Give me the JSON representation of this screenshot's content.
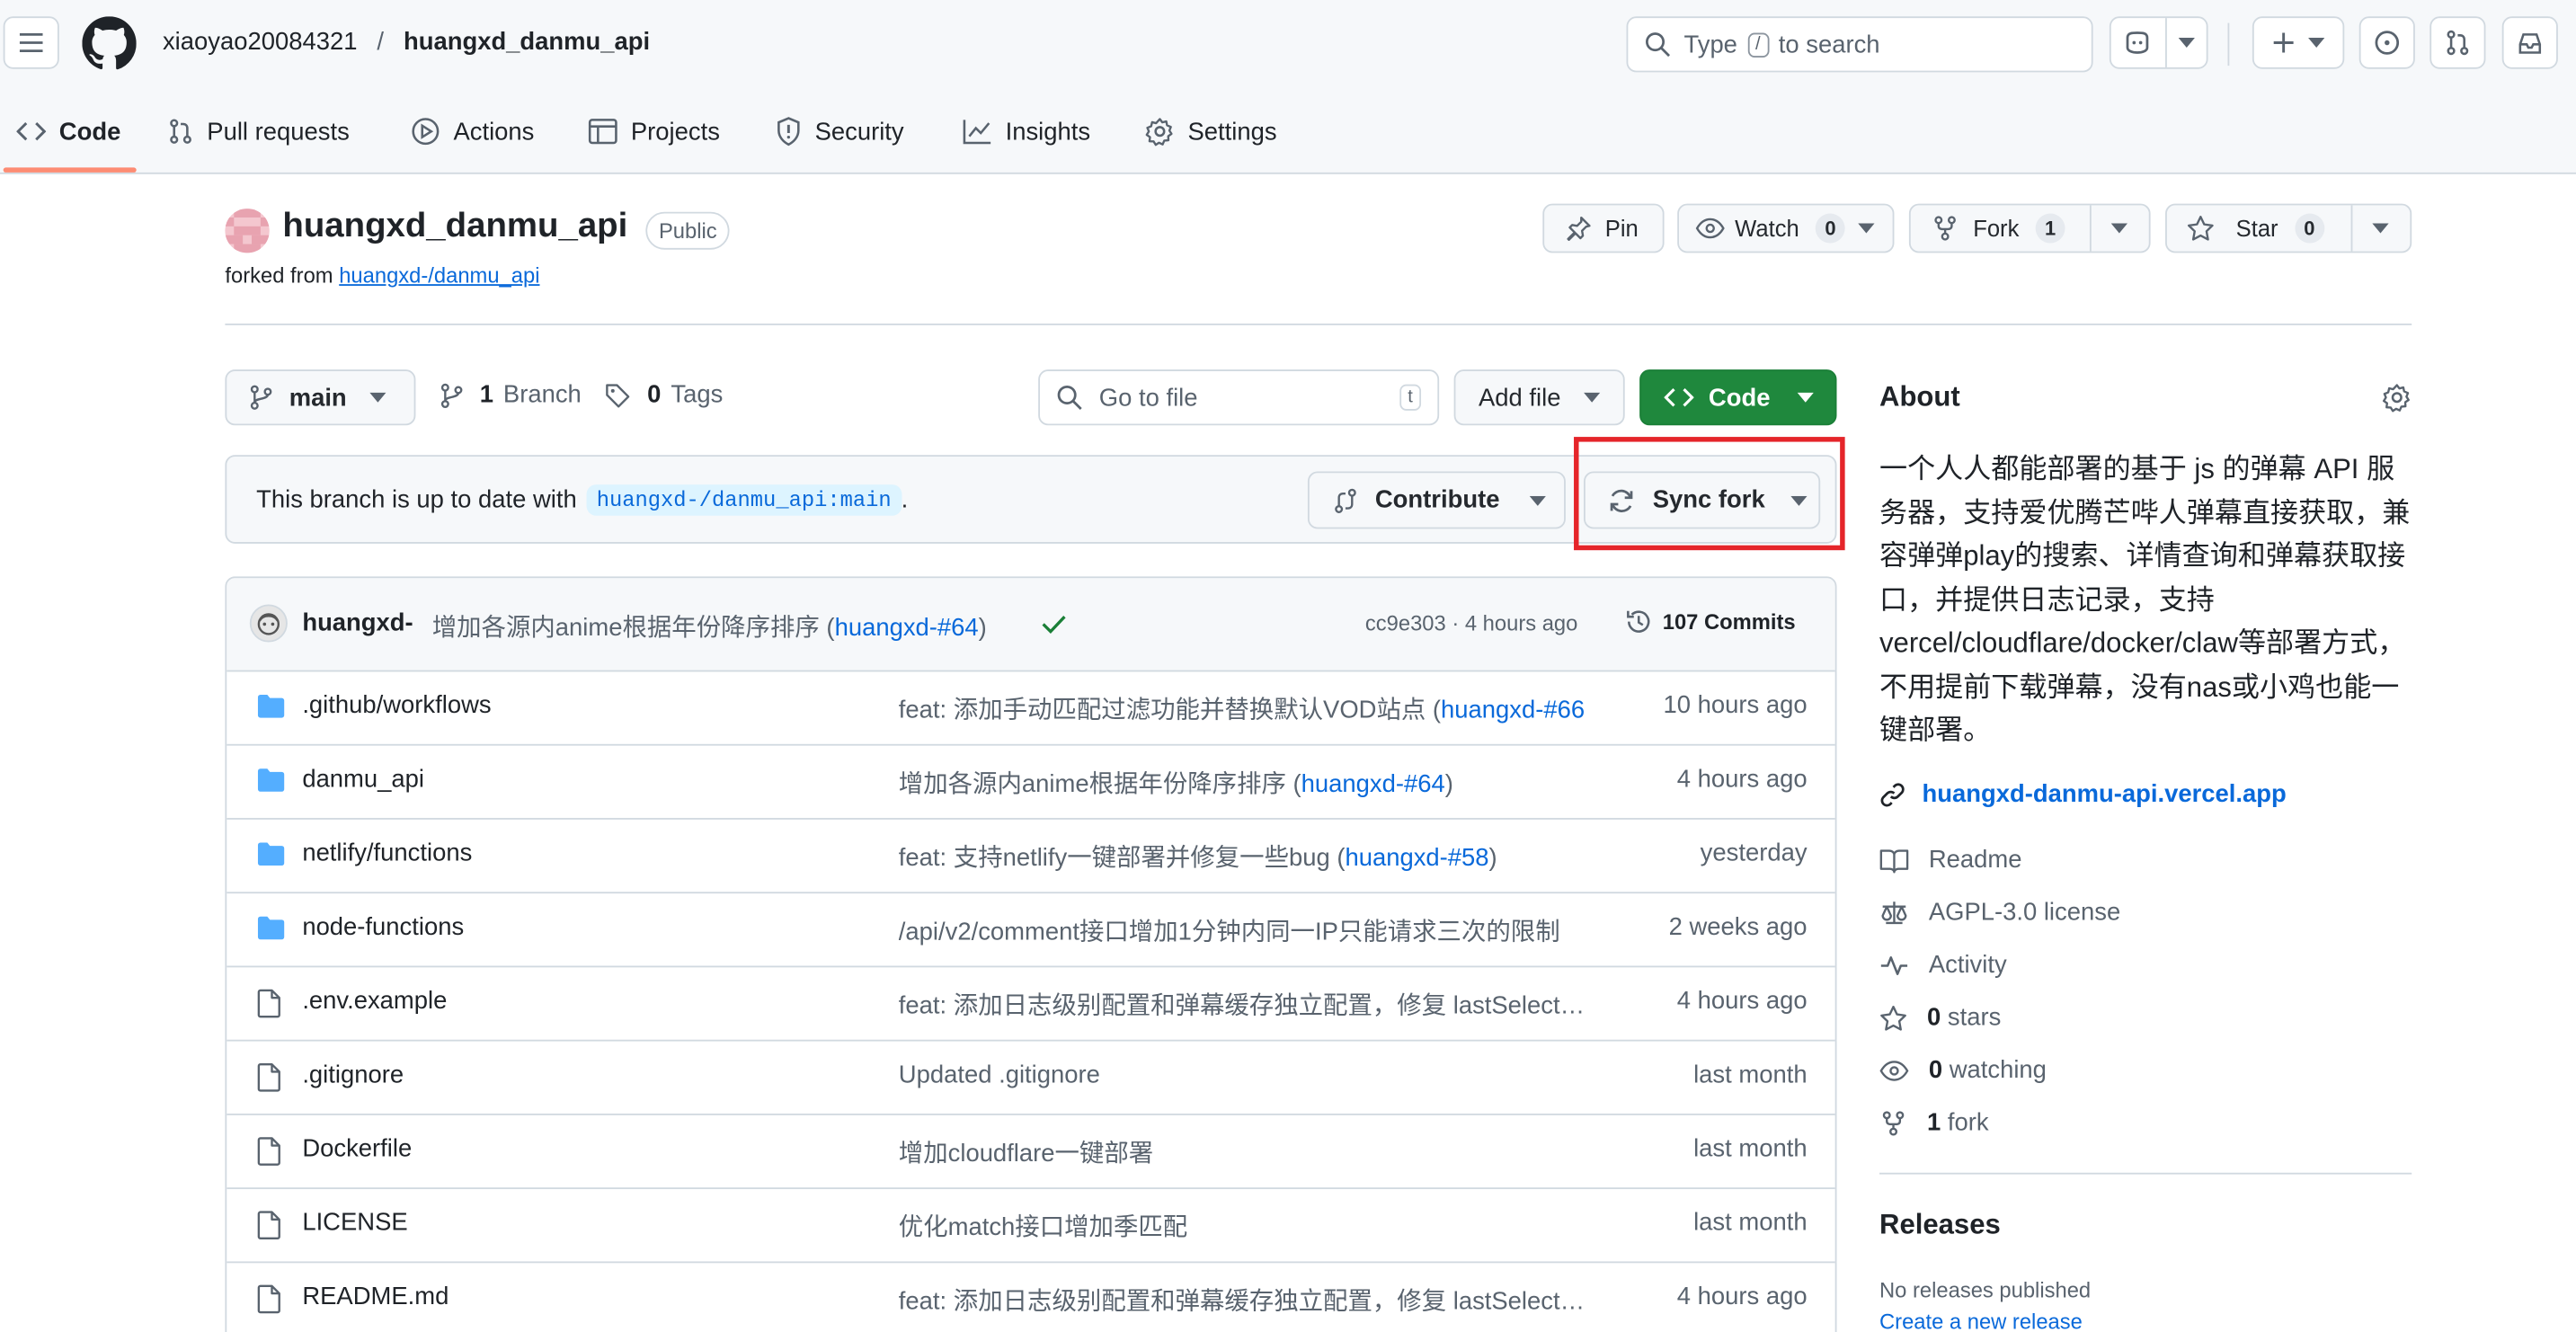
{
  "header": {
    "owner": "xiaoyao20084321",
    "slash": "/",
    "repo": "huangxd_danmu_api",
    "search_type": "Type",
    "search_key": "/",
    "search_rest": "to search"
  },
  "tabs": [
    {
      "label": "Code"
    },
    {
      "label": "Pull requests"
    },
    {
      "label": "Actions"
    },
    {
      "label": "Projects"
    },
    {
      "label": "Security"
    },
    {
      "label": "Insights"
    },
    {
      "label": "Settings"
    }
  ],
  "repo": {
    "name": "huangxd_danmu_api",
    "visibility": "Public",
    "forked_prefix": "forked from",
    "forked_from": "huangxd-/danmu_api",
    "pin_label": "Pin",
    "watch_label": "Watch",
    "watch_count": "0",
    "fork_label": "Fork",
    "fork_count": "1",
    "star_label": "Star",
    "star_count": "0"
  },
  "toolbar": {
    "branch": "main",
    "branch_count": "1",
    "branch_word": "Branch",
    "tag_count": "0",
    "tag_word": "Tags",
    "go_to_file": "Go to file",
    "go_to_file_key": "t",
    "add_file": "Add file",
    "code": "Code"
  },
  "sync": {
    "text": "This branch is up to date with",
    "ref": "huangxd-/danmu_api:main",
    "period": ".",
    "contribute": "Contribute",
    "sync_fork": "Sync fork",
    "highlight_color": "#e5252a"
  },
  "commit": {
    "author": "huangxd-",
    "message": "增加各源内anime根据年份降序排序 (",
    "pr": "huangxd-#64",
    "close": ")",
    "sha_time": "cc9e303 · 4 hours ago",
    "commits": "107 Commits"
  },
  "files": [
    {
      "name": ".github/workflows",
      "type": "folder",
      "msg": "feat: 添加手动匹配过滤功能并替换默认VOD站点 (",
      "link": "huangxd-#66",
      "tail": "",
      "time": "10 hours ago"
    },
    {
      "name": "danmu_api",
      "type": "folder",
      "msg": "增加各源内anime根据年份降序排序 (",
      "link": "huangxd-#64",
      "tail": ")",
      "time": "4 hours ago"
    },
    {
      "name": "netlify/functions",
      "type": "folder",
      "msg": "feat: 支持netlify一键部署并修复一些bug (",
      "link": "huangxd-#58",
      "tail": ")",
      "time": "yesterday"
    },
    {
      "name": "node-functions",
      "type": "folder",
      "msg": "/api/v2/comment接口增加1分钟内同一IP只能请求三次的限制",
      "link": "",
      "tail": "",
      "time": "2 weeks ago"
    },
    {
      "name": ".env.example",
      "type": "file",
      "msg": "feat: 添加日志级别配置和弹幕缓存独立配置，修复 lastSelectMap",
      "link": "",
      "tail": "",
      "time": "4 hours ago"
    },
    {
      "name": ".gitignore",
      "type": "file",
      "msg": "Updated .gitignore",
      "link": "",
      "tail": "",
      "time": "last month"
    },
    {
      "name": "Dockerfile",
      "type": "file",
      "msg": "增加cloudflare一键部署",
      "link": "",
      "tail": "",
      "time": "last month"
    },
    {
      "name": "LICENSE",
      "type": "file",
      "msg": "优化match接口增加季匹配",
      "link": "",
      "tail": "",
      "time": "last month"
    },
    {
      "name": "README.md",
      "type": "file",
      "msg": "feat: 添加日志级别配置和弹幕缓存独立配置，修复 lastSelectMap",
      "link": "",
      "tail": "",
      "time": "4 hours ago"
    }
  ],
  "about": {
    "title": "About",
    "description": "一个人人都能部署的基于 js 的弹幕 API 服务器，支持爱优腾芒哔人弹幕直接获取，兼容弹弹play的搜索、详情查询和弹幕获取接口，并提供日志记录，支持vercel/cloudflare/docker/claw等部署方式，不用提前下载弹幕，没有nas或小鸡也能一键部署。",
    "website": "huangxd-danmu-api.vercel.app",
    "readme": "Readme",
    "license": "AGPL-3.0 license",
    "activity": "Activity",
    "stars_count": "0",
    "stars_word": "stars",
    "watching_count": "0",
    "watching_word": "watching",
    "fork_count": "1",
    "fork_word": "fork"
  },
  "releases": {
    "title": "Releases",
    "none": "No releases published",
    "create": "Create a new release"
  }
}
